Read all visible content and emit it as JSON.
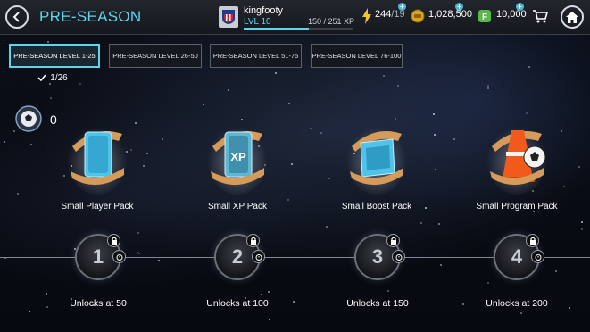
{
  "header": {
    "title": "PRE-SEASON",
    "username": "kingfooty",
    "level": "LVL 10",
    "xp": "150 / 251 XP",
    "xp_progress": 0.6,
    "energy": "244",
    "energy_max": "/19",
    "coins": "1,028,500",
    "points": "10,000"
  },
  "tabs": [
    {
      "label": "PRE-SEASON LEVEL 1-25",
      "active": true
    },
    {
      "label": "PRE-SEASON LEVEL 26-50",
      "active": false
    },
    {
      "label": "PRE-SEASON LEVEL 51-75",
      "active": false
    },
    {
      "label": "PRE-SEASON LEVEL 76-100",
      "active": false
    }
  ],
  "tab_progress": "1/26",
  "token_count": "0",
  "packs": [
    {
      "label": "Small Player Pack",
      "icon": "player-pack-icon"
    },
    {
      "label": "Small XP Pack",
      "icon": "xp-pack-icon"
    },
    {
      "label": "Small Boost Pack",
      "icon": "boost-pack-icon"
    },
    {
      "label": "Small Program Pack",
      "icon": "program-pack-icon"
    }
  ],
  "milestones": [
    {
      "number": "1",
      "unlock": "Unlocks at 50"
    },
    {
      "number": "2",
      "unlock": "Unlocks at 100"
    },
    {
      "number": "3",
      "unlock": "Unlocks at 150"
    },
    {
      "number": "4",
      "unlock": "Unlocks at 200"
    }
  ],
  "colors": {
    "accent": "#5fd4ee",
    "ribbon": "#d69a5a",
    "pack_blue": "#4fc3e8",
    "coin_gold": "#d9a520",
    "points_green": "#58b848",
    "energy_yellow": "#f2c230"
  }
}
